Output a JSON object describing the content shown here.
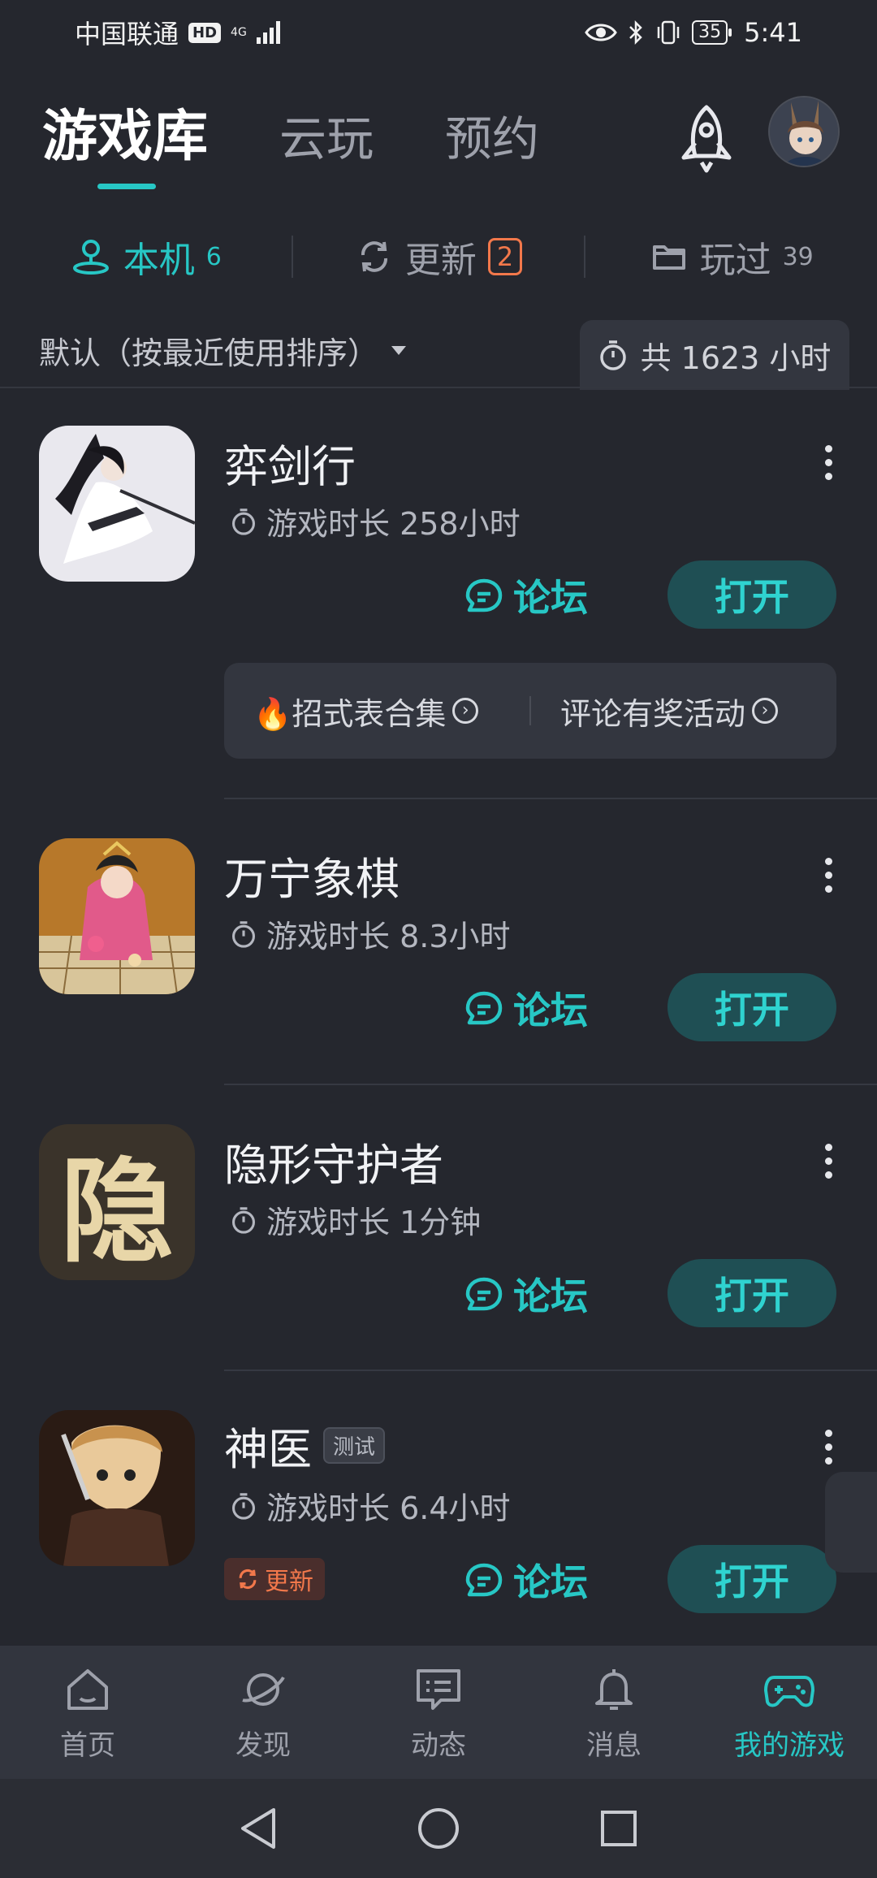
{
  "status_bar": {
    "carrier": "中国联通",
    "hd": "HD",
    "network_top": "4G",
    "network_bottom": "⁴⁶",
    "battery": "35",
    "time": "5:41"
  },
  "header": {
    "tabs": [
      {
        "label": "游戏库",
        "active": true
      },
      {
        "label": "云玩",
        "active": false
      },
      {
        "label": "预约",
        "active": false
      }
    ]
  },
  "subtabs": [
    {
      "label": "本机",
      "count": "6",
      "active": true
    },
    {
      "label": "更新",
      "badge": "2",
      "active": false
    },
    {
      "label": "玩过",
      "count": "39",
      "active": false
    }
  ],
  "sort": {
    "label": "默认（按最近使用排序）",
    "total": "共 1623 小时"
  },
  "games": [
    {
      "title": "弈剑行",
      "time_label": "游戏时长 258小时",
      "forum_label": "论坛",
      "open_label": "打开",
      "info_card": {
        "left": "🔥招式表合集",
        "right": "评论有奖活动"
      }
    },
    {
      "title": "万宁象棋",
      "time_label": "游戏时长 8.3小时",
      "forum_label": "论坛",
      "open_label": "打开"
    },
    {
      "title": "隐形守护者",
      "time_label": "游戏时长 1分钟",
      "forum_label": "论坛",
      "open_label": "打开",
      "icon_char": "隐"
    },
    {
      "title": "神医",
      "tag": "测试",
      "time_label": "游戏时长 6.4小时",
      "forum_label": "论坛",
      "open_label": "打开",
      "update_label": "更新"
    }
  ],
  "bottom_nav": [
    {
      "label": "首页",
      "icon": "home-icon",
      "active": false
    },
    {
      "label": "发现",
      "icon": "planet-icon",
      "active": false
    },
    {
      "label": "动态",
      "icon": "message-icon",
      "active": false
    },
    {
      "label": "消息",
      "icon": "bell-icon",
      "active": false
    },
    {
      "label": "我的游戏",
      "icon": "gamepad-icon",
      "active": true
    }
  ],
  "colors": {
    "background": "#25272e",
    "accent": "#27c7c5",
    "open_button_bg": "#1f4f54",
    "update_orange": "#f2784b",
    "nav_bg": "#32353e"
  }
}
